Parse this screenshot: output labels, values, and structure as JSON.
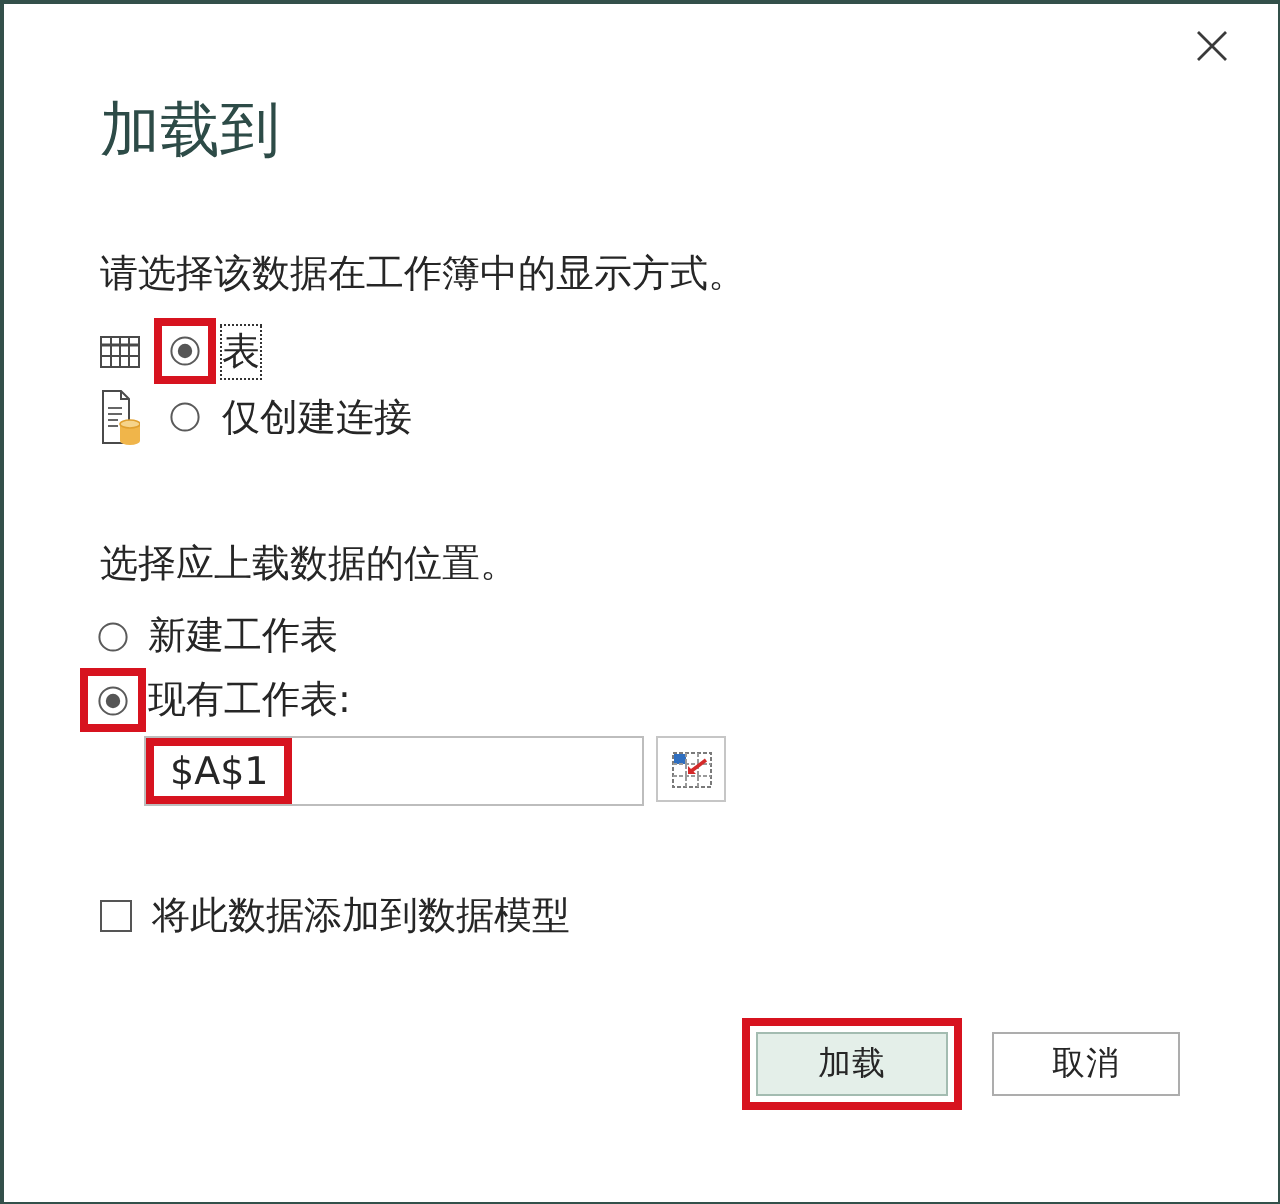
{
  "dialog": {
    "title": "加载到"
  },
  "display": {
    "prompt": "请选择该数据在工作簿中的显示方式。",
    "options": [
      {
        "kind": "table",
        "label": "表",
        "selected": true,
        "focused": true,
        "highlighted": true
      },
      {
        "kind": "connection",
        "label": "仅创建连接",
        "selected": false,
        "focused": false,
        "highlighted": false
      }
    ]
  },
  "location": {
    "prompt": "选择应上载数据的位置。",
    "options": [
      {
        "label": "新建工作表",
        "selected": false,
        "highlighted": false
      },
      {
        "label": "现有工作表:",
        "selected": true,
        "highlighted": true
      }
    ],
    "range_field": {
      "value": "$A$1",
      "highlighted": true
    }
  },
  "data_model": {
    "label": "将此数据添加到数据模型",
    "checked": false
  },
  "buttons": [
    {
      "kind": "primary",
      "label": "加载",
      "highlighted": true
    },
    {
      "kind": "secondary",
      "label": "取消",
      "highlighted": false
    }
  ]
}
